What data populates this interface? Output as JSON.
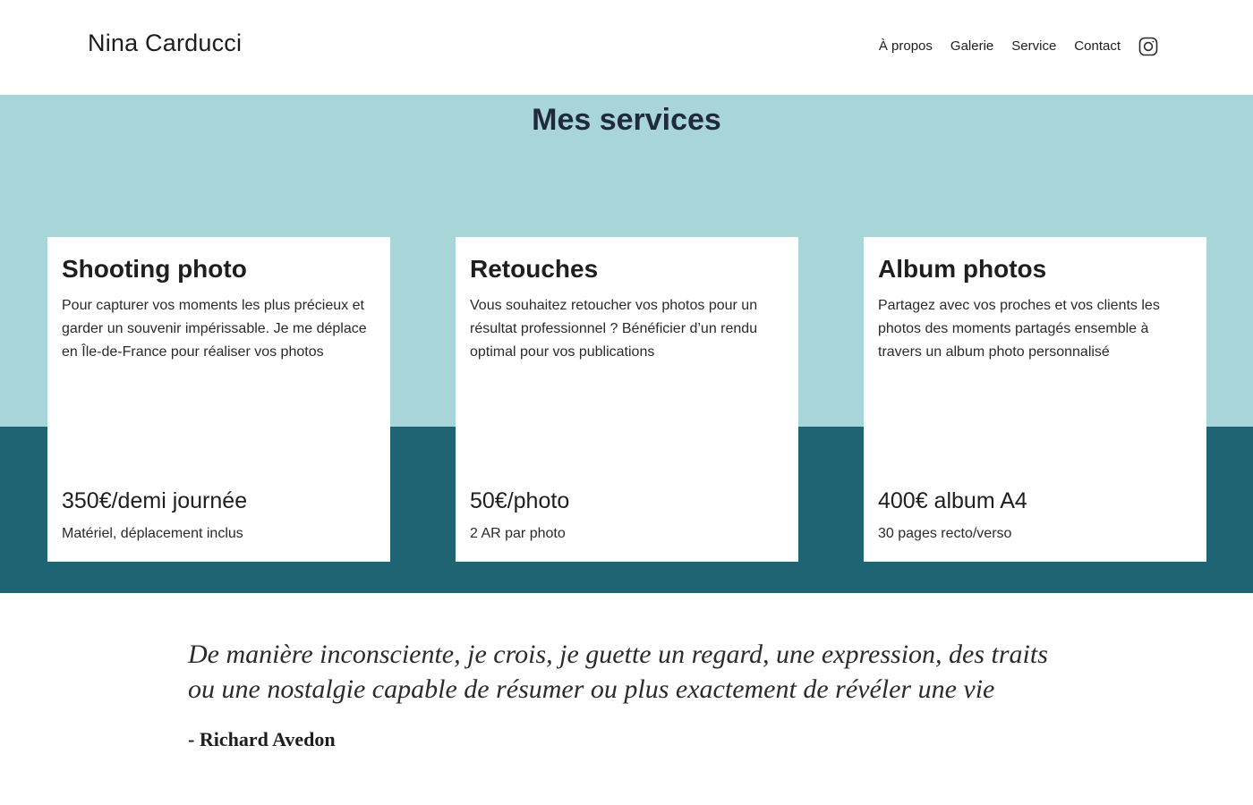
{
  "header": {
    "brand": "Nina Carducci",
    "nav": {
      "about": "À propos",
      "gallery": "Galerie",
      "service": "Service",
      "contact": "Contact"
    },
    "social_icon": "instagram-icon"
  },
  "services": {
    "title": "Mes services",
    "cards": [
      {
        "title": "Shooting photo",
        "description": "Pour capturer vos moments les plus précieux et garder un souvenir impérissable. Je me déplace en Île-de-France pour réaliser vos photos",
        "price": "350€/demi journée",
        "note": "Matériel, déplacement inclus"
      },
      {
        "title": "Retouches",
        "description": "Vous souhaitez retoucher vos photos pour un résultat professionnel ? Bénéficier d’un rendu optimal pour vos publications",
        "price": "50€/photo",
        "note": "2 AR par photo"
      },
      {
        "title": "Album photos",
        "description": "Partagez avec vos proches et vos clients les photos des moments partagés ensemble à travers un album photo personnalisé",
        "price": "400€ album A4",
        "note": "30 pages recto/verso"
      }
    ]
  },
  "quote": {
    "text": "De manière inconsciente, je crois, je guette un regard, une expression, des traits ou une nostalgie capable de résumer ou plus exactement de révéler une vie",
    "author": "- Richard Avedon"
  },
  "colors": {
    "light_band": "#a8d5d8",
    "dark_band": "#1e6472",
    "card_background": "#ffffff"
  }
}
